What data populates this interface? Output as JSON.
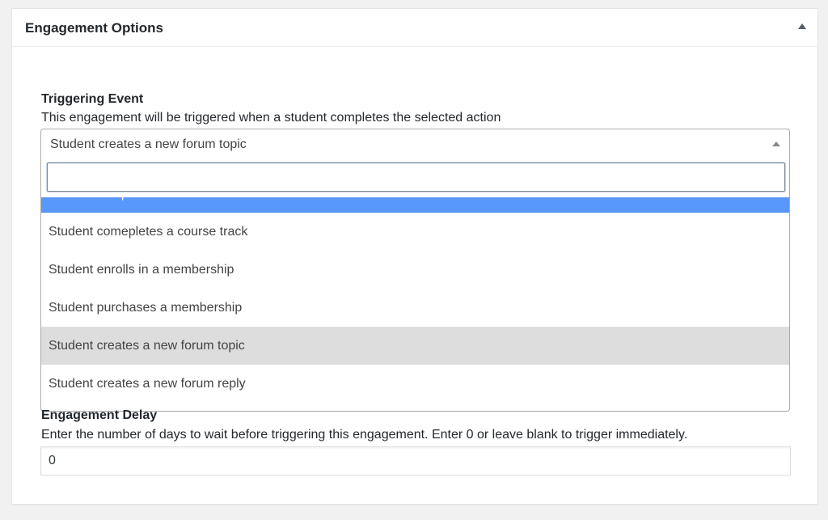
{
  "metabox": {
    "title": "Engagement Options",
    "toggle_icon": "triangle-up-icon"
  },
  "triggering_event": {
    "label": "Triggering Event",
    "description": "This engagement will be triggered when a student completes the selected action",
    "selected_value": "Student creates a new forum topic",
    "search_value": "",
    "options": [
      {
        "label": "Student completes a section",
        "state": "highlighted"
      },
      {
        "label": "Student comepletes a course track",
        "state": "normal"
      },
      {
        "label": "Student enrolls in a membership",
        "state": "normal"
      },
      {
        "label": "Student purchases a membership",
        "state": "normal"
      },
      {
        "label": "Student creates a new forum topic",
        "state": "selected"
      },
      {
        "label": "Student creates a new forum reply",
        "state": "normal"
      }
    ]
  },
  "engagement_delay": {
    "label": "Engagement Delay",
    "description": "Enter the number of days to wait before triggering this engagement. Enter 0 or leave blank to trigger immediately.",
    "value": "0"
  },
  "colors": {
    "highlight": "#5897fb",
    "selected": "#dddddd",
    "page_background": "#f1f1f1"
  }
}
